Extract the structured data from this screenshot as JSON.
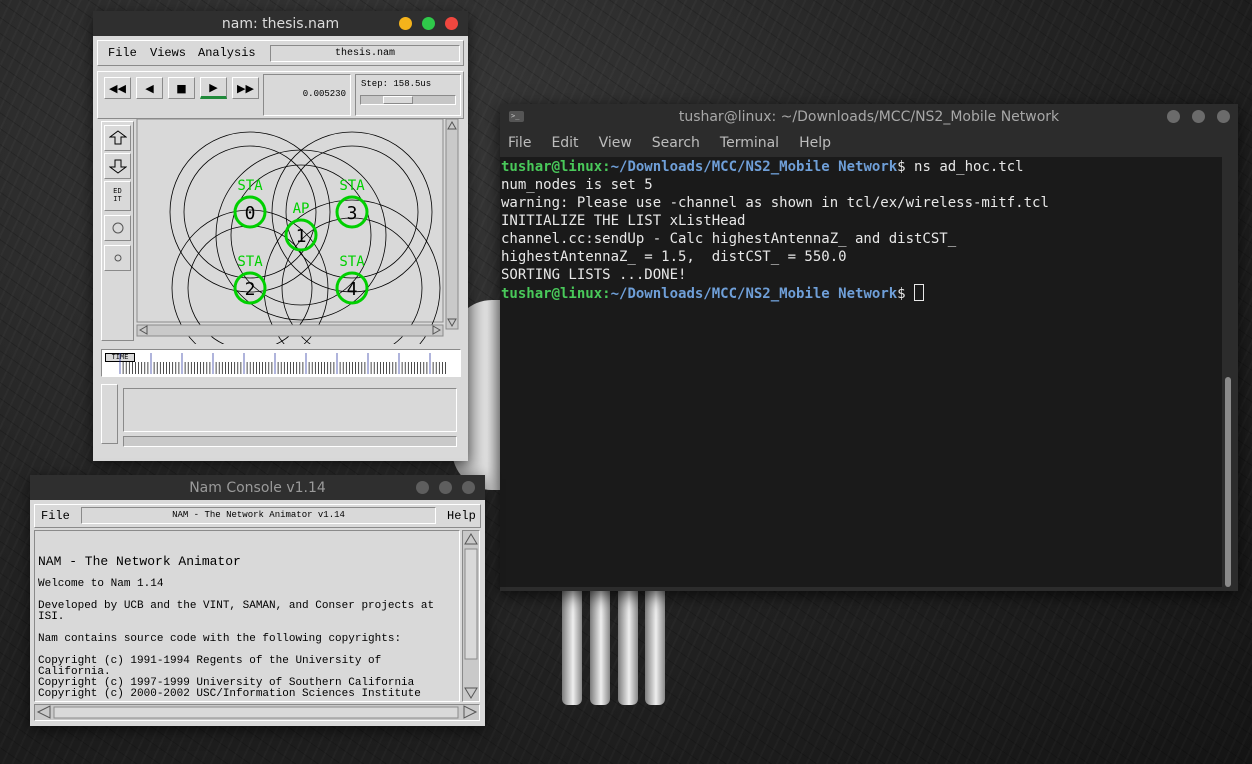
{
  "nam": {
    "title": "nam: thesis.nam",
    "menu": {
      "file": "File",
      "views": "Views",
      "analysis": "Analysis"
    },
    "filename": "thesis.nam",
    "time": "0.005230",
    "step": "Step: 158.5us",
    "edit_label": "ED\nIT",
    "time_label": "TIME",
    "nodes": [
      {
        "label": "STA",
        "id": "0"
      },
      {
        "label": "AP",
        "id": "1"
      },
      {
        "label": "STA",
        "id": "3"
      },
      {
        "label": "STA",
        "id": "2"
      },
      {
        "label": "STA",
        "id": "4"
      }
    ],
    "node_color": "#00d000"
  },
  "console": {
    "title": "Nam Console v1.14",
    "menu": {
      "file": "File",
      "help": "Help"
    },
    "header": "NAM - The Network Animator v1.14",
    "lines": {
      "heading": "NAM - The Network Animator",
      "welcome": "Welcome to Nam 1.14",
      "developed": "Developed by UCB and the VINT, SAMAN, and Conser projects at ISI.",
      "contains": "Nam contains source code with the following copyrights:",
      "copy1": "Copyright (c) 1991-1994 Regents of the University of California.",
      "copy2": "Copyright (c) 1997-1999 University of Southern California",
      "copy3": "Copyright (c) 2000-2002 USC/Information Sciences Institute"
    }
  },
  "terminal": {
    "title": "tushar@linux: ~/Downloads/MCC/NS2_Mobile Network",
    "menu": [
      "File",
      "Edit",
      "View",
      "Search",
      "Terminal",
      "Help"
    ],
    "prompt_user": "tushar@linux",
    "prompt_path": "~/Downloads/MCC/NS2_Mobile Network",
    "command": " ns ad_hoc.tcl",
    "output": [
      "num_nodes is set 5",
      "warning: Please use -channel as shown in tcl/ex/wireless-mitf.tcl",
      "INITIALIZE THE LIST xListHead",
      "channel.cc:sendUp - Calc highestAntennaZ_ and distCST_",
      "highestAntennaZ_ = 1.5,  distCST_ = 550.0",
      "SORTING LISTS ...DONE!"
    ]
  }
}
